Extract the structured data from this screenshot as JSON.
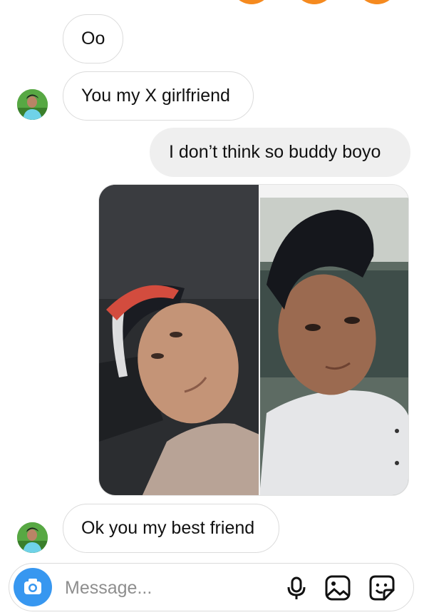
{
  "thread": {
    "messages": [
      {
        "direction": "incoming",
        "text": "Oo"
      },
      {
        "direction": "incoming",
        "text": "You my X girlfriend"
      },
      {
        "direction": "outgoing",
        "text": "I don’t think so buddy boyo"
      },
      {
        "direction": "incoming",
        "type": "photo-collage"
      },
      {
        "direction": "incoming",
        "text": "Ok you my best friend"
      }
    ]
  },
  "composer": {
    "placeholder": "Message..."
  },
  "icons": {
    "camera": "camera-icon",
    "microphone": "microphone-icon",
    "gallery": "gallery-icon",
    "sticker": "sticker-icon"
  },
  "colors": {
    "accent": "#3797f0",
    "outgoing_bubble": "#efefef",
    "bubble_border": "#dbdbdb",
    "placeholder": "#8e8e8e"
  }
}
